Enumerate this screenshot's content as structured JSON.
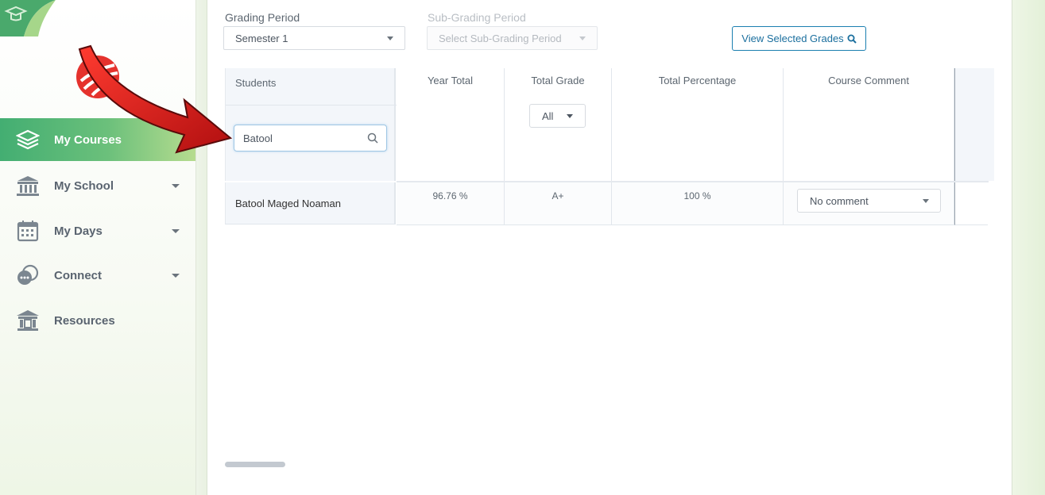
{
  "sidebar": {
    "items": [
      {
        "label": "My Courses",
        "icon": "layers-icon",
        "active": true
      },
      {
        "label": "My School",
        "icon": "school-building-icon"
      },
      {
        "label": "My Days",
        "icon": "calendar-icon"
      },
      {
        "label": "Connect",
        "icon": "chat-bubbles-icon"
      },
      {
        "label": "Resources",
        "icon": "library-building-icon"
      }
    ]
  },
  "filters": {
    "grading_period_label": "Grading Period",
    "grading_period_value": "Semester 1",
    "sub_grading_period_label": "Sub-Grading Period",
    "sub_grading_period_placeholder": "Select Sub-Grading Period",
    "view_button_label": "View Selected Grades"
  },
  "table": {
    "columns": {
      "students": "Students",
      "year_total": "Year Total",
      "total_grade": "Total Grade",
      "total_percentage": "Total Percentage",
      "course_comment": "Course Comment"
    },
    "search_value": "Batool",
    "grade_filter_value": "All",
    "rows": [
      {
        "student": "Batool Maged Noaman",
        "year_total": "96.76 %",
        "total_grade": "A+",
        "total_percentage": "100 %",
        "course_comment": "No comment"
      }
    ]
  },
  "colors": {
    "active_nav_start": "#43ae72",
    "active_nav_end": "#b6dc8f",
    "button_border": "#1b7fb0",
    "annotation_arrow": "#e01b1b"
  }
}
